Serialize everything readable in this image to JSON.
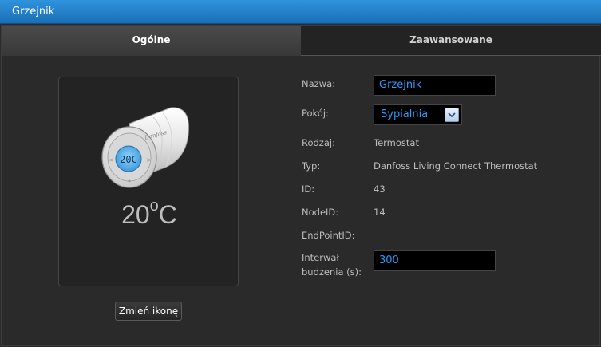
{
  "window": {
    "title": "Grzejnik"
  },
  "tabs": [
    {
      "label": "Ogólne",
      "active": true
    },
    {
      "label": "Zaawansowane",
      "active": false
    }
  ],
  "device": {
    "icon": "thermostat-icon",
    "temperature": "20",
    "unit_degree": "o",
    "unit": "C",
    "lcd_text": "20C",
    "brand_text": "Danfoss",
    "change_icon_label": "Zmień ikonę"
  },
  "form": {
    "name_label": "Nazwa:",
    "name_value": "Grzejnik",
    "room_label": "Pokój:",
    "room_value": "Sypialnia",
    "type_label": "Rodzaj:",
    "type_value": "Termostat",
    "model_label": "Typ:",
    "model_value": "Danfoss Living Connect Thermostat",
    "id_label": "ID:",
    "id_value": "43",
    "nodeid_label": "NodeID:",
    "nodeid_value": "14",
    "endpoint_label": "EndPointID:",
    "endpoint_value": "",
    "wake_label_line1": "Interwał",
    "wake_label_line2": "budzenia (s):",
    "wake_value": "300"
  },
  "colors": {
    "titlebar": "#1f7cc4",
    "accent_text": "#2a9dff",
    "background": "#2a2a2a"
  }
}
